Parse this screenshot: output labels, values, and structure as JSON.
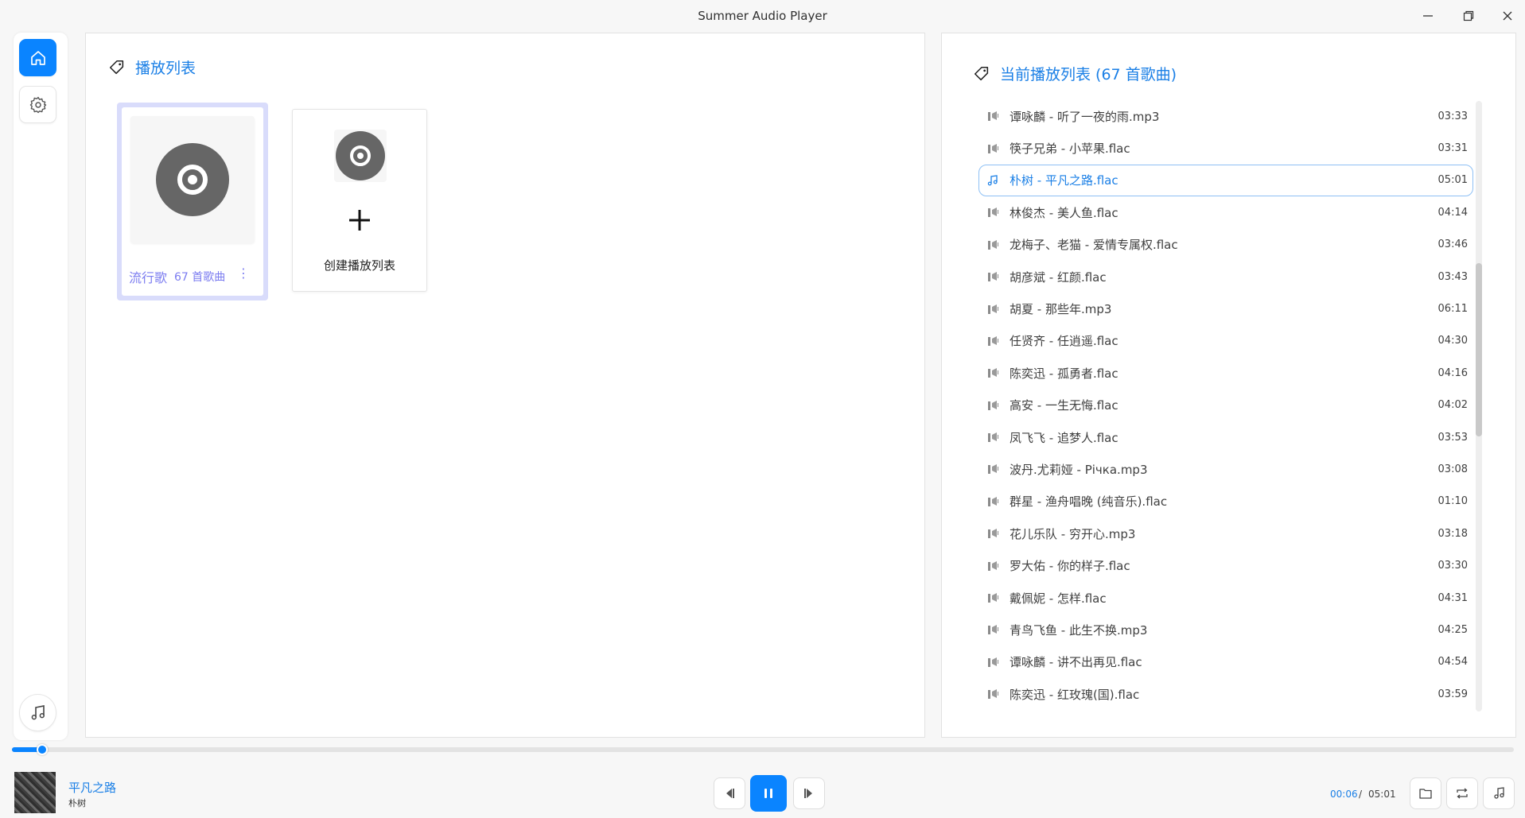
{
  "window": {
    "title": "Summer Audio Player",
    "controls": [
      "minimize-icon",
      "maximize-icon",
      "close-icon"
    ]
  },
  "sidebar": {
    "items": [
      {
        "name": "home",
        "icon": "home-icon",
        "active": true
      },
      {
        "name": "settings",
        "icon": "gear-icon",
        "active": false
      }
    ],
    "bottom": {
      "icon": "music-note-icon"
    }
  },
  "playlists_panel": {
    "title": "播放列表",
    "icon": "tag-icon",
    "playlists": [
      {
        "name": "流行歌",
        "count": "67 首歌曲",
        "menu": "⋮"
      }
    ],
    "create_label": "创建播放列表"
  },
  "current_panel": {
    "title": "当前播放列表 (67 首歌曲)",
    "icon": "tag-icon",
    "songs": [
      {
        "name": "谭咏麟 - 听了一夜的雨.mp3",
        "duration": "03:33",
        "playing": false
      },
      {
        "name": "筷子兄弟 - 小苹果.flac",
        "duration": "03:31",
        "playing": false
      },
      {
        "name": "朴树 - 平凡之路.flac",
        "duration": "05:01",
        "playing": true
      },
      {
        "name": "林俊杰 - 美人鱼.flac",
        "duration": "04:14",
        "playing": false
      },
      {
        "name": "龙梅子、老猫 - 爱情专属权.flac",
        "duration": "03:46",
        "playing": false
      },
      {
        "name": "胡彦斌 - 红颜.flac",
        "duration": "03:43",
        "playing": false
      },
      {
        "name": "胡夏 - 那些年.mp3",
        "duration": "06:11",
        "playing": false
      },
      {
        "name": "任贤齐 - 任逍遥.flac",
        "duration": "04:30",
        "playing": false
      },
      {
        "name": "陈奕迅 - 孤勇者.flac",
        "duration": "04:16",
        "playing": false
      },
      {
        "name": "高安 - 一生无悔.flac",
        "duration": "04:02",
        "playing": false
      },
      {
        "name": "凤飞飞 - 追梦人.flac",
        "duration": "03:53",
        "playing": false
      },
      {
        "name": "波丹.尤莉娅 - Річка.mp3",
        "duration": "03:08",
        "playing": false
      },
      {
        "name": "群星 - 渔舟唱晚 (纯音乐).flac",
        "duration": "01:10",
        "playing": false
      },
      {
        "name": "花儿乐队 - 穷开心.mp3",
        "duration": "03:18",
        "playing": false
      },
      {
        "name": "罗大佑 - 你的样子.flac",
        "duration": "03:30",
        "playing": false
      },
      {
        "name": "戴佩妮 - 怎样.flac",
        "duration": "04:31",
        "playing": false
      },
      {
        "name": "青鸟飞鱼 - 此生不换.mp3",
        "duration": "04:25",
        "playing": false
      },
      {
        "name": "谭咏麟 - 讲不出再见.flac",
        "duration": "04:54",
        "playing": false
      },
      {
        "name": "陈奕迅 - 红玫瑰(国).flac",
        "duration": "03:59",
        "playing": false
      }
    ]
  },
  "player": {
    "title": "平凡之路",
    "artist": "朴树",
    "current_time": "00:06",
    "separator": "/",
    "total_time": "05:01",
    "progress": 0.02,
    "controls": [
      "previous-icon",
      "pause-icon",
      "next-icon"
    ],
    "right_buttons": [
      "folder-icon",
      "repeat-icon",
      "playlist-icon"
    ]
  },
  "colors": {
    "accent": "#0a84ff",
    "title_blue": "#1a7fe6",
    "playlist_purple": "#7b7cf0",
    "selection_bg": "#d9dcfb"
  }
}
